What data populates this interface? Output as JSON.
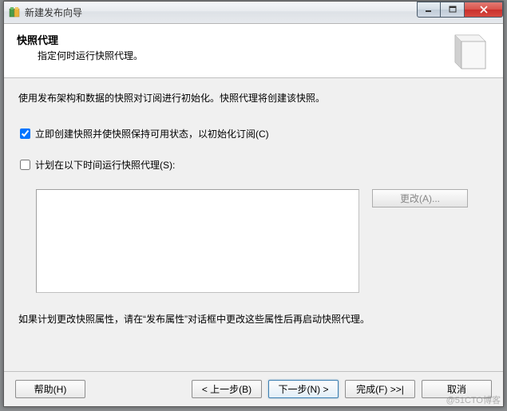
{
  "window": {
    "title": "新建发布向导"
  },
  "header": {
    "title": "快照代理",
    "subtitle": "指定何时运行快照代理。"
  },
  "content": {
    "description": "使用发布架构和数据的快照对订阅进行初始化。快照代理将创建该快照。",
    "checkbox1_label": "立即创建快照并使快照保持可用状态，以初始化订阅(C)",
    "checkbox2_label": "计划在以下时间运行快照代理(S):",
    "change_button": "更改(A)...",
    "note": "如果计划更改快照属性，请在“发布属性”对话框中更改这些属性后再启动快照代理。"
  },
  "buttons": {
    "help": "帮助(H)",
    "back": "< 上一步(B)",
    "next": "下一步(N) >",
    "finish": "完成(F) >>|",
    "cancel": "取消"
  },
  "watermark": "@51CTO博客"
}
